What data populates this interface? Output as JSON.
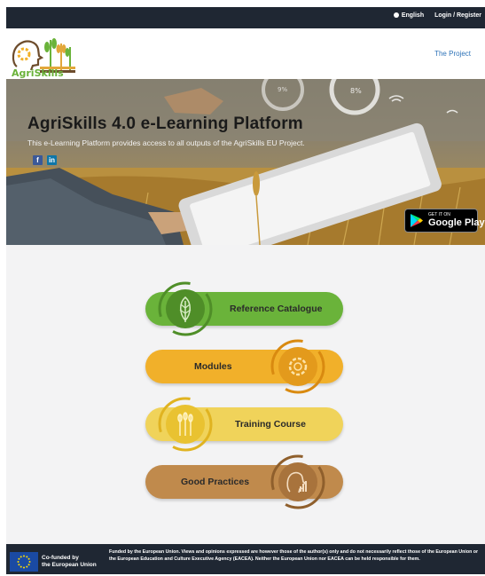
{
  "topbar": {
    "language": "English",
    "login": "Login / Register"
  },
  "header": {
    "logo_text": "AgriSkills",
    "nav_project": "The Project"
  },
  "hero": {
    "title": "AgriSkills 4.0 e-Learning Platform",
    "subtitle": "This e-Learning Platform provides access to all outputs of the AgriSkills EU Project.",
    "facebook": "f",
    "linkedin": "in",
    "google_play_small": "GET IT ON",
    "google_play_big": "Google Play"
  },
  "menu": [
    {
      "label": "Reference Catalogue",
      "icon": "leaf-icon",
      "color": "#6ab33a"
    },
    {
      "label": "Modules",
      "icon": "gear-icon",
      "color": "#f1b02a"
    },
    {
      "label": "Training Course",
      "icon": "wheat-icon",
      "color": "#f0d35a"
    },
    {
      "label": "Good Practices",
      "icon": "practices-icon",
      "color": "#c08a4c"
    }
  ],
  "footer": {
    "cofunded_line1": "Co-funded by",
    "cofunded_line2": "the European Union",
    "disclaimer": "Funded by the European Union. Views and opinions expressed are however those of the author(s) only and do not necessarily reflect those of the European Union or the European Education and Culture Executive Agency (EACEA). Neither the European Union nor EACEA can be held responsible for them."
  }
}
